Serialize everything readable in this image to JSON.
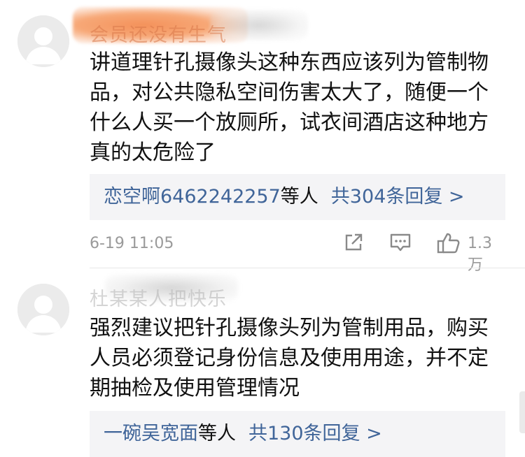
{
  "comments": [
    {
      "username": "会员还没有生气",
      "text": "讲道理针孔摄像头这种东西应该列为管制物品，对公共隐私空间伤害太大了，随便一个什么人买一个放厕所，试衣间酒店这种地方真的太危险了",
      "replies": {
        "who": "恋空啊6462242257",
        "suffix": "等人",
        "count_label": "共304条回复 >"
      },
      "time": "6-19 11:05",
      "likes": "1.3万"
    },
    {
      "username": "杜某某人把快乐",
      "text": "强烈建议把针孔摄像头列为管制用品，购买人员必须登记身份信息及使用用途，并不定期抽检及使用管理情况",
      "replies": {
        "who": "一碗吴宽面",
        "suffix": "等人",
        "count_label": "共130条回复 >"
      }
    }
  ],
  "icons": {
    "share": "share-icon",
    "comment": "comment-icon",
    "like": "thumbs-up-icon"
  },
  "colors": {
    "link_blue": "#406599",
    "reply_bg": "#f4f4f6",
    "meta_gray": "#9a9a9a",
    "censor_orange": "#f08a50"
  }
}
